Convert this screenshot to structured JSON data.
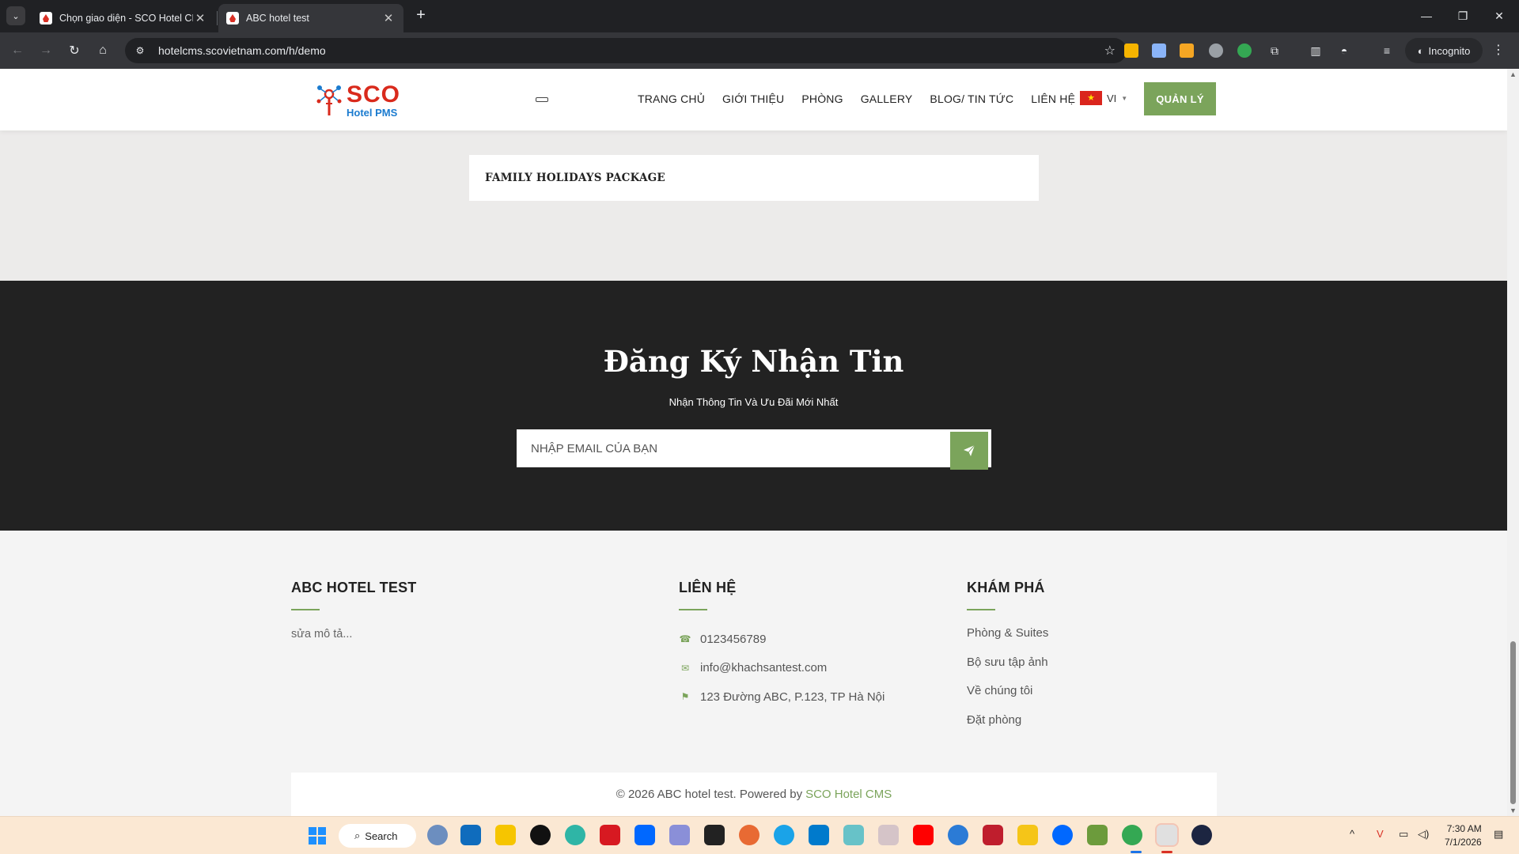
{
  "browser": {
    "tabs": [
      {
        "title": "Chọn giao diện - SCO Hotel CMS",
        "active": false
      },
      {
        "title": "ABC hotel test",
        "active": true
      }
    ],
    "url": "hotelcms.scovietnam.com/h/demo",
    "incognito_label": "Incognito"
  },
  "header": {
    "logo_big": "SCO",
    "logo_small": "Hotel PMS",
    "nav": [
      "TRANG CHỦ",
      "GIỚI THIỆU",
      "PHÒNG",
      "GALLERY",
      "BLOG/ TIN TỨC",
      "LIÊN HỆ"
    ],
    "lang": "VI",
    "manage_label": "QUẢN LÝ"
  },
  "package": {
    "title": "FAMILY HOLIDAYS PACKAGE"
  },
  "newsletter": {
    "title": "Đăng Ký Nhận Tin",
    "subtitle": "Nhận Thông Tin Và Ưu Đãi Mới Nhất",
    "placeholder": "NHẬP EMAIL CỦA BẠN"
  },
  "footer": {
    "about": {
      "title": "ABC HOTEL TEST",
      "desc": "sửa mô tả..."
    },
    "contact": {
      "title": "LIÊN HỆ",
      "phone": "0123456789",
      "email": "info@khachsantest.com",
      "address": "123 Đường ABC, P.123, TP Hà Nội"
    },
    "explore": {
      "title": "KHÁM PHÁ",
      "links": [
        "Phòng & Suites",
        "Bộ sưu tập ảnh",
        "Về chúng tôi",
        "Đặt phòng"
      ]
    },
    "copyright_prefix": "© 2026 ABC hotel test. Powered by",
    "copyright_brand": "SCO Hotel CMS"
  },
  "taskbar": {
    "search_label": "Search",
    "time": "7:30 AM",
    "date": "7/1/2026"
  },
  "colors": {
    "accent_green": "#7ba45b",
    "newsletter_bg": "#222222",
    "logo_red": "#d92a1c",
    "logo_blue": "#1b7bcf"
  }
}
